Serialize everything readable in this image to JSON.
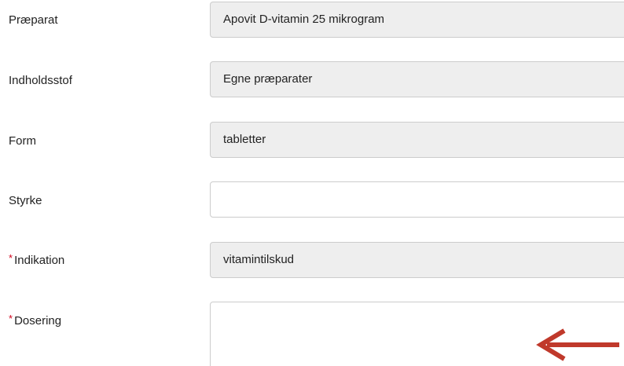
{
  "form": {
    "fields": [
      {
        "label": "Præparat",
        "value": "Apovit D-vitamin 25 mikrogram",
        "required": false,
        "editable": false
      },
      {
        "label": "Indholdsstof",
        "value": "Egne præparater",
        "required": false,
        "editable": false
      },
      {
        "label": "Form",
        "value": "tabletter",
        "required": false,
        "editable": false
      },
      {
        "label": "Styrke",
        "value": "",
        "required": false,
        "editable": true
      },
      {
        "label": "Indikation",
        "value": "vitamintilskud",
        "required": true,
        "editable": false
      },
      {
        "label": "Dosering",
        "value": "",
        "required": true,
        "editable": true
      }
    ],
    "required_marker": "*"
  },
  "colors": {
    "required_marker": "#d0021b",
    "readonly_background": "#eeeeee",
    "field_border": "#cccccc",
    "arrow": "#c0392b"
  },
  "icons": {
    "annotation_arrow": "left-arrow-icon"
  }
}
